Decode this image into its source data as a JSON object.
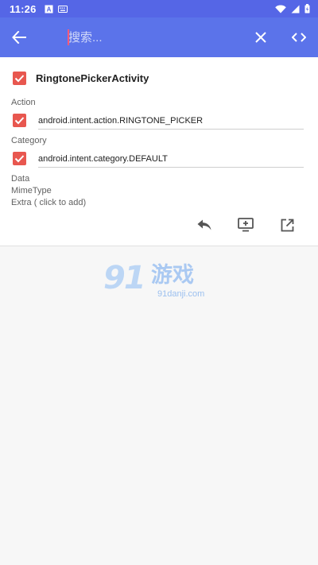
{
  "status_bar": {
    "time": "11:26",
    "left_icons": [
      "a-box-icon",
      "keyboard-icon"
    ],
    "right_icons": [
      "wifi-icon",
      "signal-icon",
      "battery-icon"
    ]
  },
  "toolbar": {
    "back_icon": "arrow-left-icon",
    "search_placeholder": "搜索...",
    "clear_icon": "close-icon",
    "code_icon": "code-icon",
    "background_color": "#5b73ea"
  },
  "activity": {
    "checked": true,
    "name": "RingtonePickerActivity"
  },
  "action": {
    "label": "Action",
    "checked": true,
    "value": "android.intent.action.RINGTONE_PICKER"
  },
  "category": {
    "label": "Category",
    "checked": true,
    "value": "android.intent.category.DEFAULT"
  },
  "extras": {
    "data_label": "Data",
    "mime_label": "MimeType",
    "extra_label": "Extra ( click to add)"
  },
  "actions": [
    "reply-icon",
    "add-to-screen-icon",
    "open-external-icon"
  ],
  "checkbox_color": "#e8574f",
  "watermark": {
    "big": "91",
    "cn": "游戏",
    "url": "91danji.com"
  }
}
